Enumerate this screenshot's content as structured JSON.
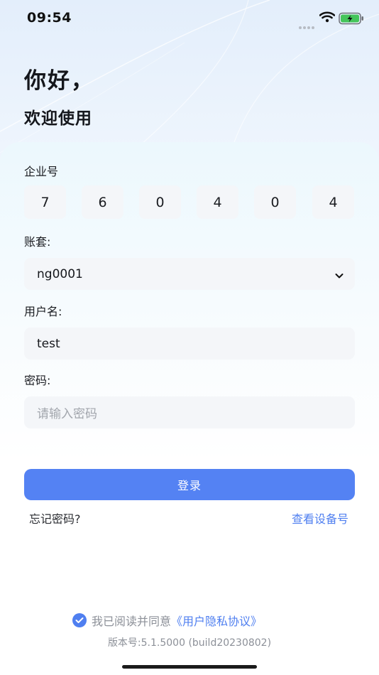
{
  "status_bar": {
    "time": "09:54"
  },
  "greeting": {
    "line1": "你好，",
    "line2": "欢迎使用"
  },
  "company": {
    "label": "企业号",
    "digits": [
      "7",
      "6",
      "0",
      "4",
      "0",
      "4"
    ]
  },
  "account_set": {
    "label": "账套:",
    "value": "ng0001"
  },
  "username": {
    "label": "用户名:",
    "value": "test"
  },
  "password": {
    "label": "密码:",
    "placeholder": "请输入密码"
  },
  "actions": {
    "login": "登录",
    "forgot": "忘记密码?",
    "device": "查看设备号"
  },
  "agreement": {
    "text": "我已阅读并同意",
    "link": "《用户隐私协议》",
    "checked": true
  },
  "version": "版本号:5.1.5000 (build20230802)",
  "colors": {
    "accent": "#5482f3",
    "link": "#4f7ff0",
    "field_bg": "#f4f6f9"
  }
}
